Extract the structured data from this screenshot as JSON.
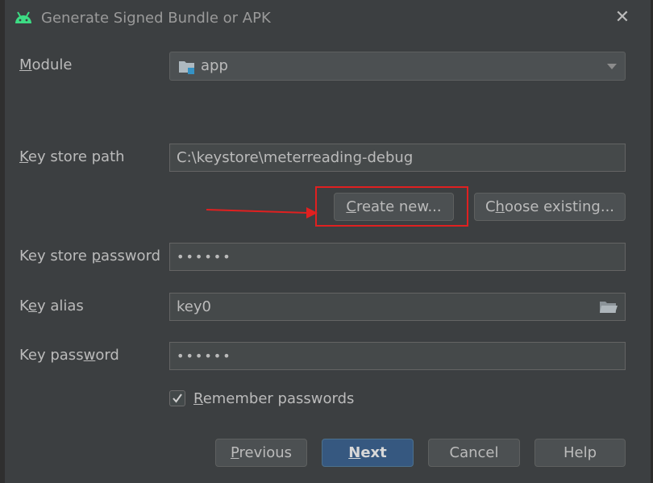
{
  "window": {
    "title": "Generate Signed Bundle or APK",
    "close_icon": "close-icon",
    "app_icon": "android-icon",
    "colors": {
      "accent": "#365880",
      "highlight": "#e02020",
      "android_green": "#3ddc84"
    }
  },
  "module": {
    "label": "Module",
    "mnemonic": "M",
    "rest": "odule",
    "value": "app"
  },
  "keystore": {
    "path_label": "Key store path",
    "path_mn": "K",
    "path_rest": "ey store path",
    "path_value": "C:\\keystore\\meterreading-debug",
    "create_new": "Create new...",
    "create_mn": "C",
    "create_rest": "reate new...",
    "choose_existing": "Choose existing...",
    "choose_pre": "C",
    "choose_mn": "h",
    "choose_rest": "oose existing...",
    "password_label": "Key store password",
    "password_pre": "Key store ",
    "password_mn": "p",
    "password_rest": "assword",
    "password_value": "••••••"
  },
  "key": {
    "alias_label": "Key alias",
    "alias_pre": "K",
    "alias_mn": "e",
    "alias_rest": "y alias",
    "alias_value": "key0",
    "password_label": "Key password",
    "password_pre": "Key pass",
    "password_mn": "w",
    "password_rest": "ord",
    "password_value": "••••••"
  },
  "remember": {
    "label": "Remember passwords",
    "mn": "R",
    "rest": "emember passwords",
    "checked": true
  },
  "buttons": {
    "previous": "Previous",
    "prev_mn": "P",
    "prev_rest": "revious",
    "next": "Next",
    "next_mn": "N",
    "next_rest": "ext",
    "cancel": "Cancel",
    "help": "Help"
  }
}
